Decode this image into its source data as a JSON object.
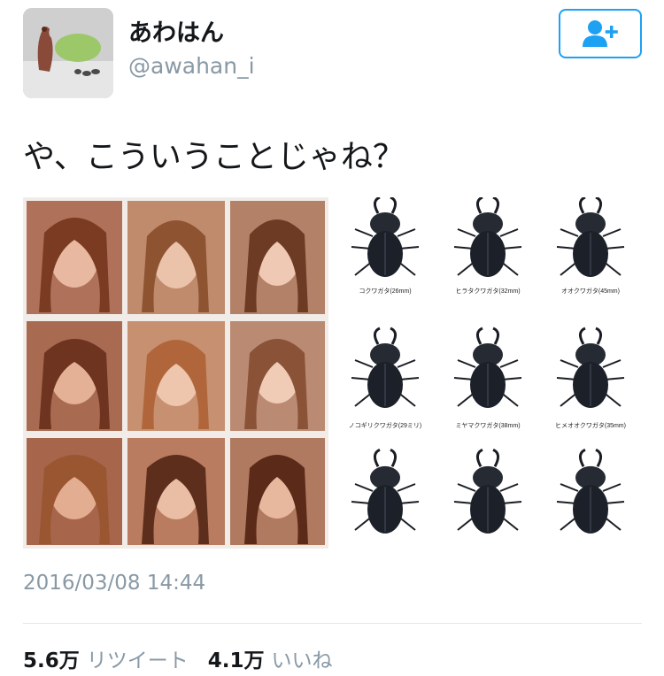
{
  "user": {
    "display_name": "あわはん",
    "handle": "@awahan_i"
  },
  "follow_button": {
    "icon": "add-user-icon",
    "color": "#1da1f2"
  },
  "tweet": {
    "text": "や、こういうことじゃね？",
    "timestamp": "2016/03/08 14:44"
  },
  "media": {
    "beetle_labels": [
      "コクワガタ(26mm)",
      "ヒラタクワガタ(32mm)",
      "オオクワガタ(45mm)",
      "ノコギリクワガタ(29ミリ)",
      "ミヤマクワガタ(38mm)",
      "ヒメオオクワガタ(35mm)"
    ]
  },
  "stats": {
    "retweet_count": "5.6万",
    "retweet_label": "リツイート",
    "like_count": "4.1万",
    "like_label": "いいね"
  }
}
